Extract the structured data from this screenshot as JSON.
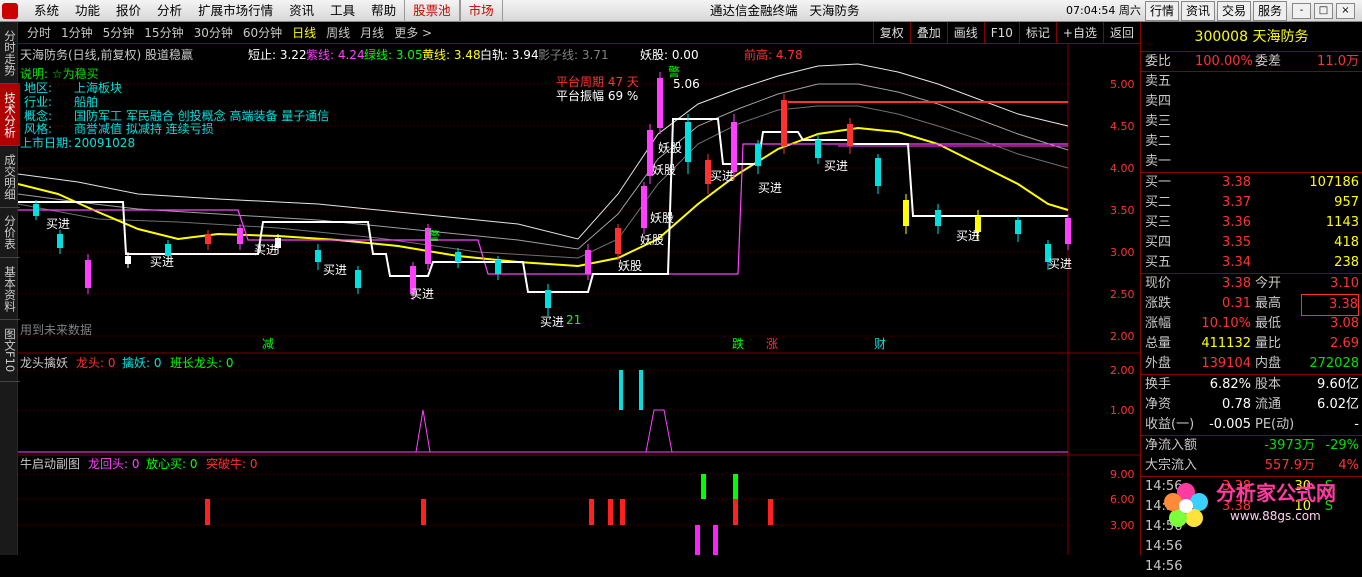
{
  "menu": {
    "items": [
      "系统",
      "功能",
      "报价",
      "分析",
      "扩展市场行情",
      "资讯",
      "工具",
      "帮助"
    ],
    "highlight": [
      "股票池",
      "市场"
    ],
    "app_title": "通达信金融终端",
    "stock_title": "天海防务",
    "clock": "07:04:54 周六",
    "buttons": [
      "行情",
      "资讯",
      "交易",
      "服务"
    ],
    "window_buttons": [
      "-",
      "□",
      "×"
    ]
  },
  "left_tabs": [
    "分时走势",
    "技术分析",
    "成交明细",
    "分价表",
    "基本资料",
    "图文F10"
  ],
  "periods": [
    "分时",
    "1分钟",
    "5分钟",
    "15分钟",
    "30分钟",
    "60分钟",
    "日线",
    "周线",
    "月线",
    "更多 >"
  ],
  "selected_period": "日线",
  "toolbar": [
    "复权",
    "叠加",
    "画线",
    "F10",
    "标记",
    "+自选",
    "返回"
  ],
  "main_chart": {
    "title": "天海防务(日线,前复权) 股道稳赢",
    "indicators": [
      {
        "label": "短止: 3.22",
        "color": "#ffffff"
      },
      {
        "label": "紫线: 4.24",
        "color": "#ff40ff"
      },
      {
        "label": "绿线: 3.05",
        "color": "#00ff00"
      },
      {
        "label": "黄线: 3.48",
        "color": "#ffff00"
      },
      {
        "label": "白轨: 3.94",
        "color": "#ffffff"
      },
      {
        "label": "影子线: 3.71",
        "color": "#808080"
      },
      {
        "label": "妖股: 0.00",
        "color": "#ffffff"
      },
      {
        "label": "前高: 4.78",
        "color": "#ff3232"
      }
    ],
    "info": {
      "desc": "说明: ☆为稳买",
      "region_label": "地区:",
      "region": "上海板块",
      "industry_label": "行业:",
      "industry": "船舶",
      "concept_label": "概念:",
      "concept": "国防军工 军民融合 创投概念 高端装备 量子通信",
      "style_label": "风格:",
      "style": "商誉减值 拟减持 连续亏损",
      "listing_label": "上市日期:",
      "listing": "20091028"
    },
    "platform_period": "平台周期 47 天",
    "platform_amplitude": "平台振幅 69 %",
    "peak_label": "5.06",
    "bottom_label": "21",
    "future_note": "用到未来数据",
    "y_ticks": [
      "5.00",
      "4.50",
      "4.00",
      "3.50",
      "3.00",
      "2.50",
      "2.00"
    ],
    "event_marks": [
      "减",
      "跌",
      "涨",
      "财"
    ],
    "signals": {
      "buy": "买进",
      "demon": "妖股",
      "warn": "警",
      "shadow": "描"
    }
  },
  "panel2": {
    "title": "龙头擒妖",
    "legend": [
      {
        "label": "龙头: 0",
        "color": "#ff3232"
      },
      {
        "label": "擒妖: 0",
        "color": "#00e0e0"
      },
      {
        "label": "班长龙头: 0",
        "color": "#00ff00"
      }
    ],
    "y_ticks": [
      "2.00",
      "1.00"
    ]
  },
  "panel3": {
    "title": "牛启动副图",
    "legend": [
      {
        "label": "龙回头: 0",
        "color": "#ff40ff"
      },
      {
        "label": "放心买: 0",
        "color": "#00ff00"
      },
      {
        "label": "突破牛: 0",
        "color": "#ff3232"
      }
    ],
    "y_ticks": [
      "9.00",
      "6.00",
      "3.00"
    ]
  },
  "quote": {
    "code": "300008",
    "name": "天海防务",
    "weibi": {
      "label": "委比",
      "value": "100.00%",
      "label2": "委差",
      "value2": "11.0万"
    },
    "sell": [
      "卖五",
      "卖四",
      "卖三",
      "卖二",
      "卖一"
    ],
    "buy": [
      {
        "label": "买一",
        "price": "3.38",
        "vol": "107186"
      },
      {
        "label": "买二",
        "price": "3.37",
        "vol": "957"
      },
      {
        "label": "买三",
        "price": "3.36",
        "vol": "1143"
      },
      {
        "label": "买四",
        "price": "3.35",
        "vol": "418"
      },
      {
        "label": "买五",
        "price": "3.34",
        "vol": "238"
      }
    ],
    "stats": [
      {
        "l1": "现价",
        "v1": "3.38",
        "c1": "red",
        "l2": "今开",
        "v2": "3.10",
        "c2": "red"
      },
      {
        "l1": "涨跌",
        "v1": "0.31",
        "c1": "red",
        "l2": "最高",
        "v2": "3.38",
        "c2": "red"
      },
      {
        "l1": "涨幅",
        "v1": "10.10%",
        "c1": "red",
        "l2": "最低",
        "v2": "3.08",
        "c2": "red"
      },
      {
        "l1": "总量",
        "v1": "411132",
        "c1": "yellow",
        "l2": "量比",
        "v2": "2.69",
        "c2": "red"
      },
      {
        "l1": "外盘",
        "v1": "139104",
        "c1": "red",
        "l2": "内盘",
        "v2": "272028",
        "c2": "green"
      }
    ],
    "fin": [
      {
        "l1": "换手",
        "v1": "6.82%",
        "l2": "股本",
        "v2": "9.60亿"
      },
      {
        "l1": "净资",
        "v1": "0.78",
        "l2": "流通",
        "v2": "6.02亿"
      },
      {
        "l1": "收益(一)",
        "v1": "-0.005",
        "l2": "PE(动)",
        "v2": "-"
      }
    ],
    "flow": [
      {
        "label": "净流入额",
        "value": "-3973万",
        "pct": "-29%",
        "c": "green"
      },
      {
        "label": "大宗流入",
        "value": "557.9万",
        "pct": "4%",
        "c": "red"
      }
    ],
    "ticks": [
      {
        "time": "14:56",
        "price": "3.38",
        "vol": "30",
        "side": "S"
      },
      {
        "time": "14:56",
        "price": "3.38",
        "vol": "10",
        "side": "S"
      },
      {
        "time": "14:56",
        "price": "",
        "vol": "",
        "side": ""
      },
      {
        "time": "14:56",
        "price": "",
        "vol": "",
        "side": ""
      },
      {
        "time": "14:56",
        "price": "",
        "vol": "",
        "side": ""
      }
    ]
  },
  "watermark": {
    "title": "分析家公式网",
    "url": "www.88gs.com"
  }
}
